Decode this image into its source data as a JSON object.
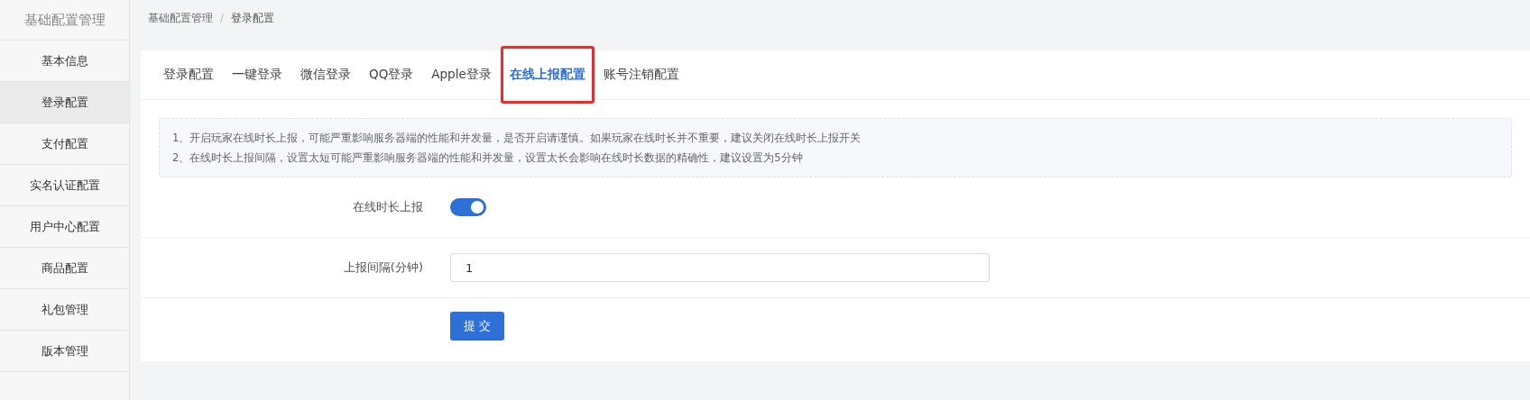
{
  "sidebar": {
    "title": "基础配置管理",
    "items": [
      {
        "label": "基本信息",
        "selected": false
      },
      {
        "label": "登录配置",
        "selected": true
      },
      {
        "label": "支付配置",
        "selected": false
      },
      {
        "label": "实名认证配置",
        "selected": false
      },
      {
        "label": "用户中心配置",
        "selected": false
      },
      {
        "label": "商品配置",
        "selected": false
      },
      {
        "label": "礼包管理",
        "selected": false
      },
      {
        "label": "版本管理",
        "selected": false
      }
    ]
  },
  "breadcrumb": [
    "基础配置管理",
    "登录配置"
  ],
  "breadcrumb_separator": "/",
  "tabs": [
    {
      "label": "登录配置",
      "selected": false
    },
    {
      "label": "一键登录",
      "selected": false
    },
    {
      "label": "微信登录",
      "selected": false
    },
    {
      "label": "QQ登录",
      "selected": false
    },
    {
      "label": "Apple登录",
      "selected": false
    },
    {
      "label": "在线上报配置",
      "selected": true
    },
    {
      "label": "账号注销配置",
      "selected": false
    }
  ],
  "notice": [
    "1、开启玩家在线时长上报，可能严重影响服务器端的性能和并发量，是否开启请谨慎。如果玩家在线时长并不重要，建议关闭在线时长上报开关",
    "2、在线时长上报间隔，设置太短可能严重影响服务器端的性能和并发量，设置太长会影响在线时长数据的精确性，建议设置为5分钟"
  ],
  "form": [
    {
      "kind": "switch",
      "label": "在线时长上报",
      "on": true
    },
    {
      "kind": "input",
      "label": "上报间隔(分钟)",
      "value": "1"
    }
  ],
  "submit": "提 交"
}
